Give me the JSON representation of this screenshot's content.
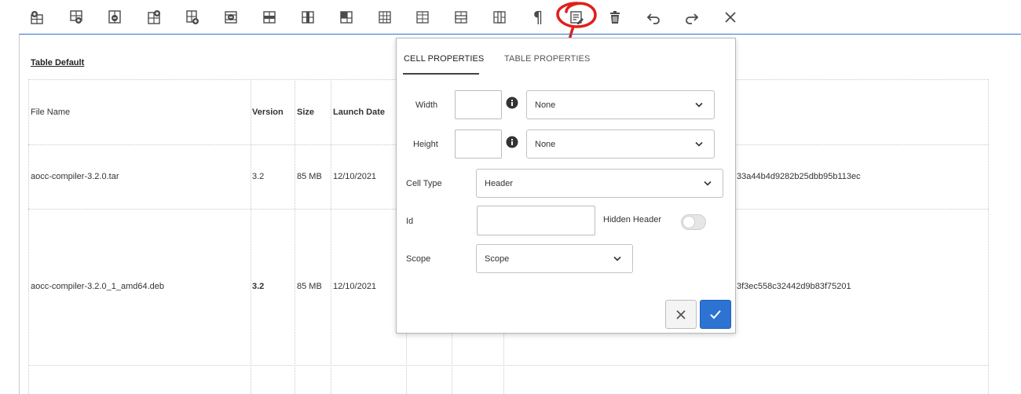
{
  "toolbar": {
    "buttons": [
      {
        "name": "insert-row-above-icon"
      },
      {
        "name": "insert-row-below-icon"
      },
      {
        "name": "delete-row-icon"
      },
      {
        "name": "insert-column-before-icon"
      },
      {
        "name": "insert-column-after-icon"
      },
      {
        "name": "delete-column-icon"
      },
      {
        "name": "select-row-icon"
      },
      {
        "name": "select-column-icon"
      },
      {
        "name": "select-cell-icon"
      },
      {
        "name": "table-grid-icon"
      },
      {
        "name": "table-grid-alt-icon"
      },
      {
        "name": "merge-cells-icon"
      },
      {
        "name": "split-cells-icon"
      },
      {
        "name": "paragraph-icon"
      },
      {
        "name": "cell-properties-icon"
      },
      {
        "name": "delete-table-icon"
      },
      {
        "name": "undo-icon"
      },
      {
        "name": "redo-icon"
      },
      {
        "name": "close-icon"
      }
    ],
    "paragraph_glyph": "¶"
  },
  "table": {
    "title": "Table Default",
    "headers": [
      "File Name",
      "Version",
      "Size",
      "Launch Date"
    ],
    "rows": [
      {
        "file": "aocc-compiler-3.2.0.tar",
        "version": "3.2",
        "size": "85 MB",
        "date": "12/10/2021",
        "hash": "33a44b4d9282b25dbb95b113ec"
      },
      {
        "file": "aocc-compiler-3.2.0_1_amd64.deb",
        "version": "3.2",
        "size": "85 MB",
        "date": "12/10/2021",
        "hash": "3f3ec558c32442d9b83f75201"
      }
    ]
  },
  "dialog": {
    "tabs": [
      {
        "label": "CELL PROPERTIES",
        "active": true
      },
      {
        "label": "TABLE PROPERTIES",
        "active": false
      }
    ],
    "width": {
      "label": "Width",
      "value": "",
      "unit": "None"
    },
    "height": {
      "label": "Height",
      "value": "",
      "unit": "None"
    },
    "cell_type": {
      "label": "Cell Type",
      "value": "Header"
    },
    "id": {
      "label": "Id",
      "value": ""
    },
    "hidden_header": {
      "label": "Hidden Header",
      "on": false
    },
    "scope": {
      "label": "Scope",
      "value": "Scope"
    }
  },
  "colors": {
    "accent": "#2d73d2",
    "annotation": "#e0201b"
  }
}
